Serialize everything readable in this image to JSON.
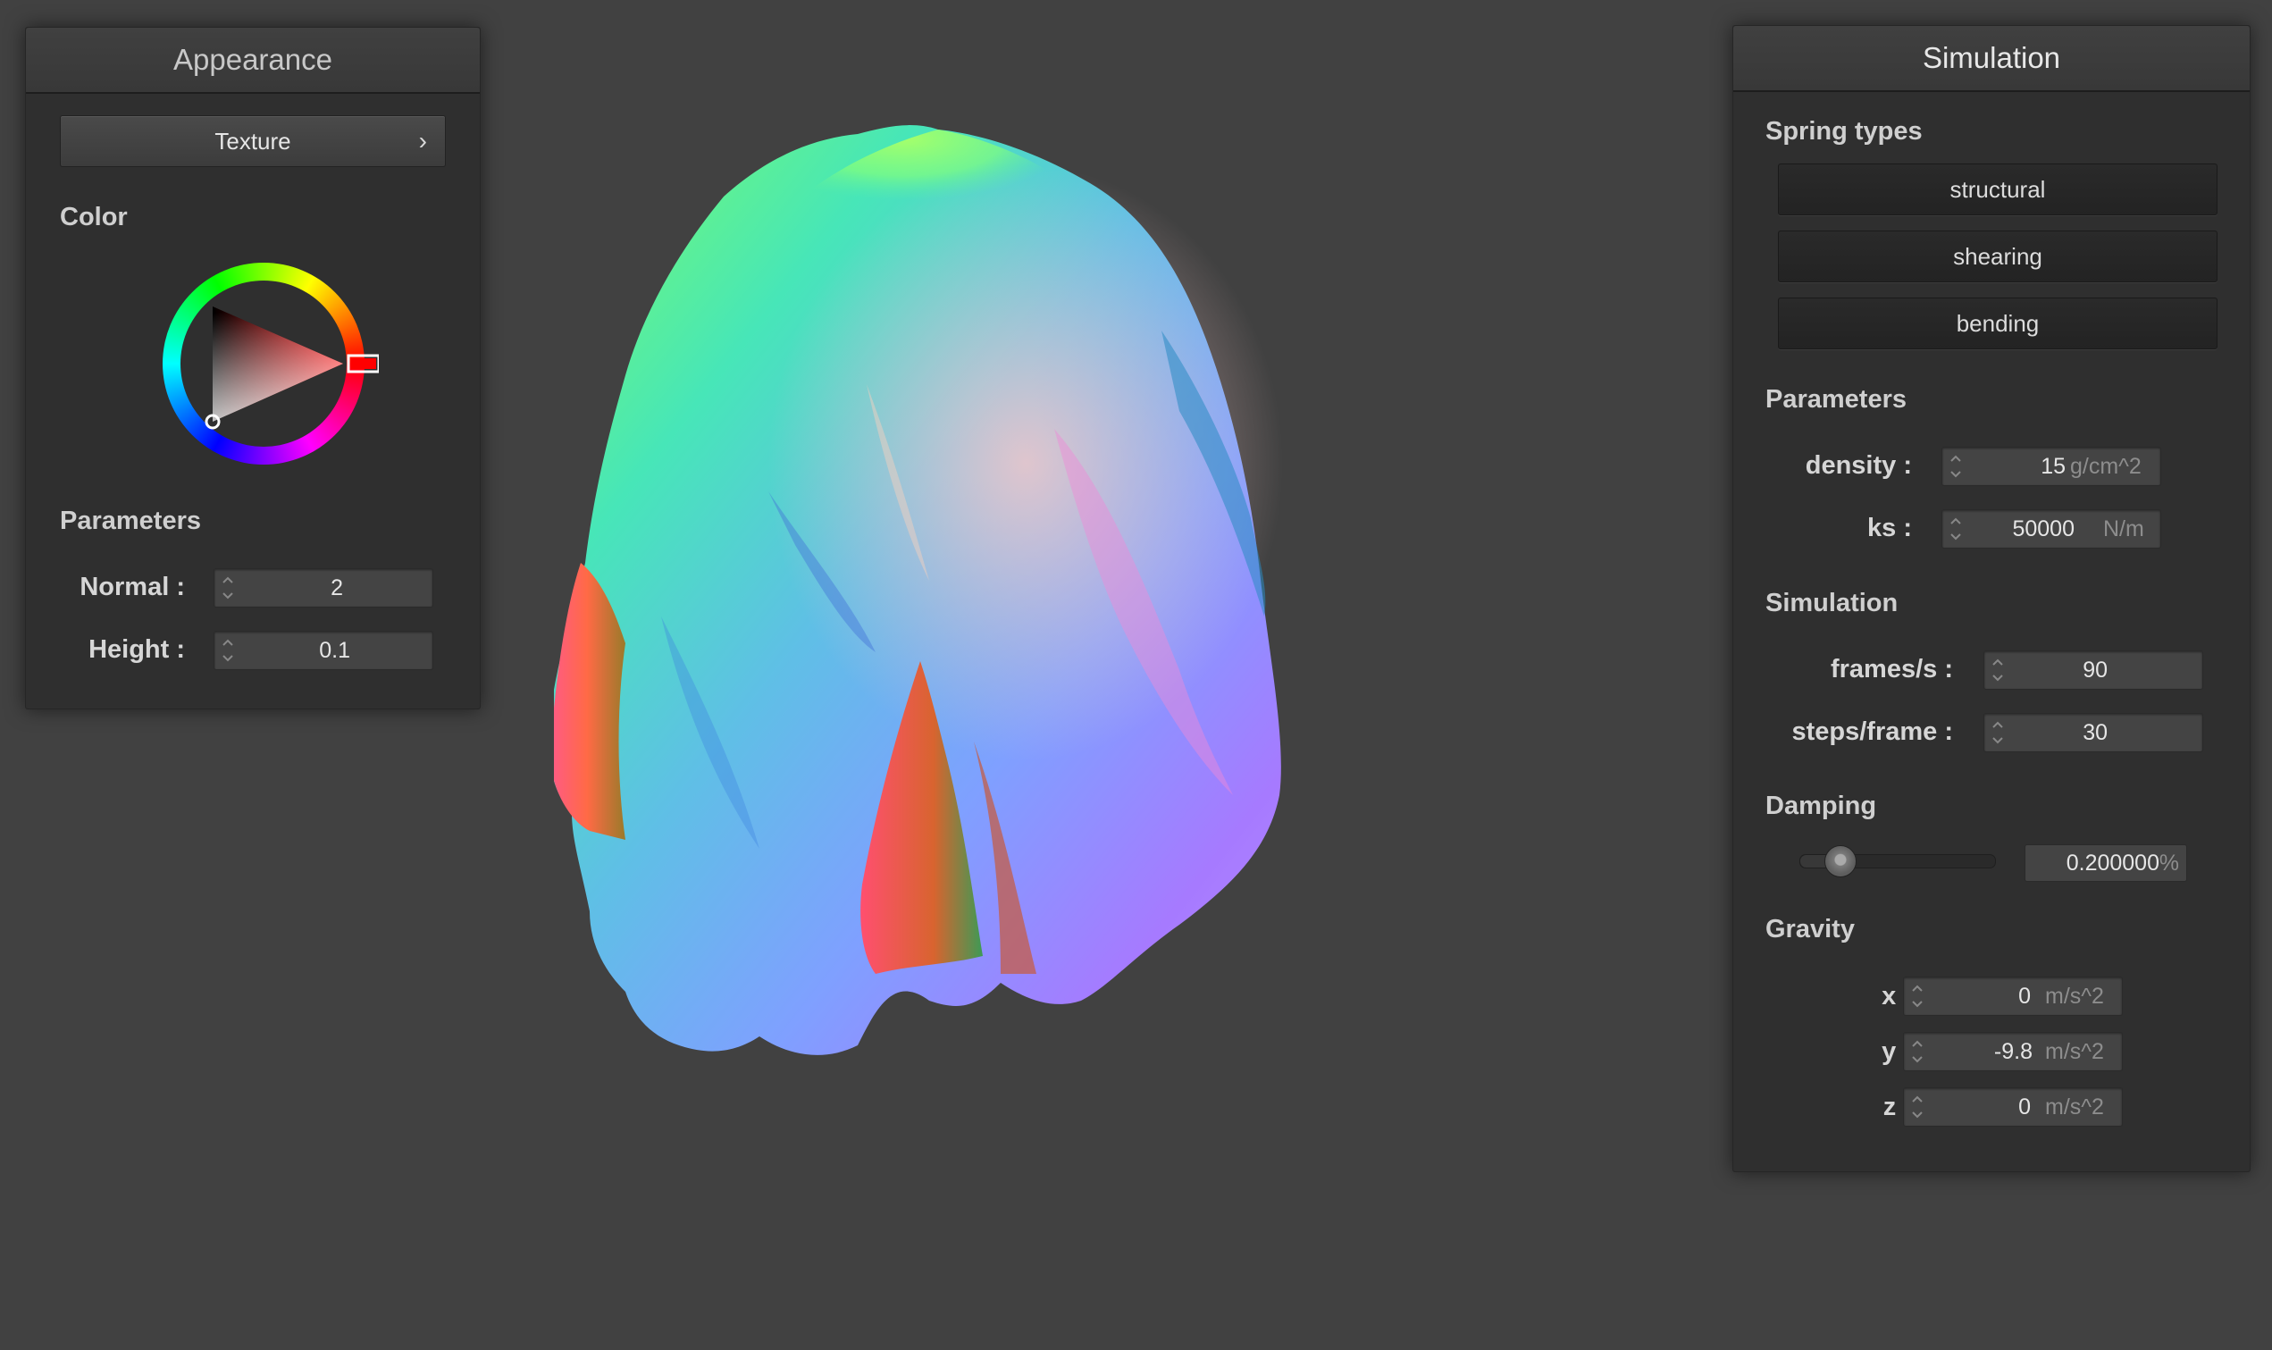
{
  "appearance": {
    "title": "Appearance",
    "texture_button": "Texture",
    "chevron_glyph": "›",
    "color_label": "Color",
    "parameters_label": "Parameters",
    "normal": {
      "label": "Normal :",
      "value": "2"
    },
    "height": {
      "label": "Height :",
      "value": "0.1"
    },
    "selected_color": "#ff0000"
  },
  "simulation": {
    "title": "Simulation",
    "spring_types_label": "Spring types",
    "springs": [
      "structural",
      "shearing",
      "bending"
    ],
    "parameters_label": "Parameters",
    "density": {
      "label": "density :",
      "value": "15",
      "unit": "g/cm^2"
    },
    "ks": {
      "label": "ks :",
      "value": "50000",
      "unit": "N/m"
    },
    "simulation_label": "Simulation",
    "frames": {
      "label": "frames/s :",
      "value": "90"
    },
    "steps": {
      "label": "steps/frame :",
      "value": "30"
    },
    "damping_label": "Damping",
    "damping": {
      "value": "0.200000",
      "unit": "%",
      "slider_fraction": 0.2
    },
    "gravity_label": "Gravity",
    "gx": {
      "label": "x :",
      "value": "0",
      "unit": "m/s^2"
    },
    "gy": {
      "label": "y :",
      "value": "-9.8",
      "unit": "m/s^2"
    },
    "gz": {
      "label": "z :",
      "value": "0",
      "unit": "m/s^2"
    }
  },
  "colors": {
    "background": "#414141",
    "panel": "#2f2f2f"
  }
}
